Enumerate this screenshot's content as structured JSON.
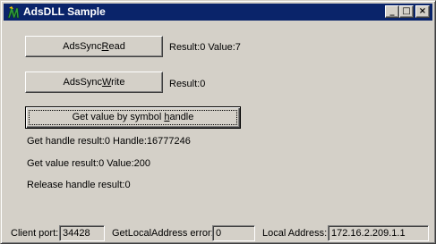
{
  "window": {
    "title": "AdsDLL Sample",
    "controls": {
      "minimize": "_",
      "maximize": "□",
      "close": "×"
    }
  },
  "buttons": {
    "read": {
      "prefix": "AdsSync",
      "underline": "R",
      "suffix": "ead"
    },
    "write": {
      "prefix": "AdsSync",
      "underline": "W",
      "suffix": "rite"
    },
    "handle": {
      "prefix": "Get value by symbol ",
      "underline": "h",
      "suffix": "andle"
    }
  },
  "results": {
    "read": "Result:0   Value:7",
    "write": "Result:0",
    "get_handle": "Get handle result:0    Handle:16777246",
    "get_value": "Get value result:0    Value:200",
    "release_handle": "Release handle result:0"
  },
  "status": {
    "client_port_label": "Client port:",
    "client_port_value": "34428",
    "local_address_error_label": "GetLocalAddress error:",
    "local_address_error_value": "0",
    "local_address_label": "Local Address:",
    "local_address_value": "172.16.2.209.1.1"
  }
}
